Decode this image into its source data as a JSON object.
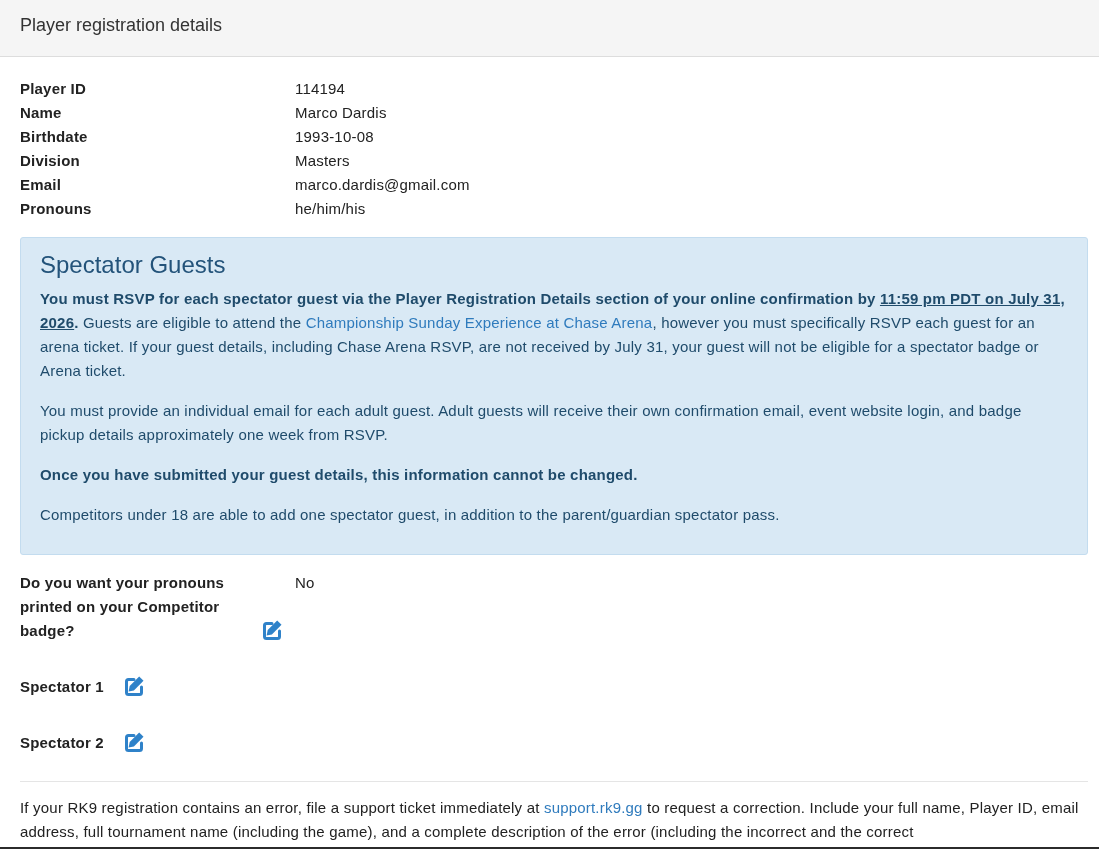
{
  "panel": {
    "title": "Player registration details"
  },
  "details": [
    {
      "label": "Player ID",
      "value": "114194"
    },
    {
      "label": "Name",
      "value": "Marco Dardis"
    },
    {
      "label": "Birthdate",
      "value": "1993-10-08"
    },
    {
      "label": "Division",
      "value": "Masters"
    },
    {
      "label": "Email",
      "value": "marco.dardis@gmail.com"
    },
    {
      "label": "Pronouns",
      "value": "he/him/his"
    }
  ],
  "spectator_guests": {
    "title": "Spectator Guests",
    "paragraphs": [
      {
        "kind": "regular",
        "segments": [
          {
            "kind": "strong",
            "text": "You must RSVP for each spectator guest via the Player Registration Details section of your online confirmation by "
          },
          {
            "kind": "strong_underline",
            "text": "11:59 pm PDT on July 31, 2026"
          },
          {
            "kind": "strong",
            "text": "."
          },
          {
            "kind": "plain",
            "text": " Guests are eligible to attend the "
          },
          {
            "kind": "link",
            "text": "Championship Sunday Experience at Chase Arena"
          },
          {
            "kind": "plain",
            "text": ", however you must specifically RSVP each guest for an arena ticket. If your guest details, including Chase Arena RSVP, are not received by July 31, your guest will not be eligible for a spectator badge or Arena ticket."
          }
        ]
      },
      {
        "kind": "regular",
        "segments": [
          {
            "kind": "plain",
            "text": "You must provide an individual email for each adult guest. Adult guests will receive their own confirmation email, event website login, and badge pickup details approximately one week from RSVP."
          }
        ]
      },
      {
        "kind": "bold",
        "segments": [
          {
            "kind": "plain",
            "text": "Once you have submitted your guest details, this information cannot be changed."
          }
        ]
      },
      {
        "kind": "regular",
        "segments": [
          {
            "kind": "plain",
            "text": "Competitors under 18 are able to add one spectator guest, in addition to the parent/guardian spectator pass."
          }
        ]
      }
    ]
  },
  "questions": [
    {
      "label": "Do you want your pronouns printed on your Competitor badge?",
      "value": "No"
    },
    {
      "label": "Spectator 1"
    },
    {
      "label": "Spectator 2"
    }
  ],
  "footer_note": {
    "segments": [
      {
        "kind": "plain",
        "text": "If your RK9 registration contains an error, file a support ticket immediately at "
      },
      {
        "kind": "link",
        "text": "support.rk9.gg"
      },
      {
        "kind": "plain",
        "text": " to request a correction. Include your full name, Player ID, email address, full tournament name (including the game), and a complete description of the error (including the incorrect and the correct"
      }
    ]
  }
}
